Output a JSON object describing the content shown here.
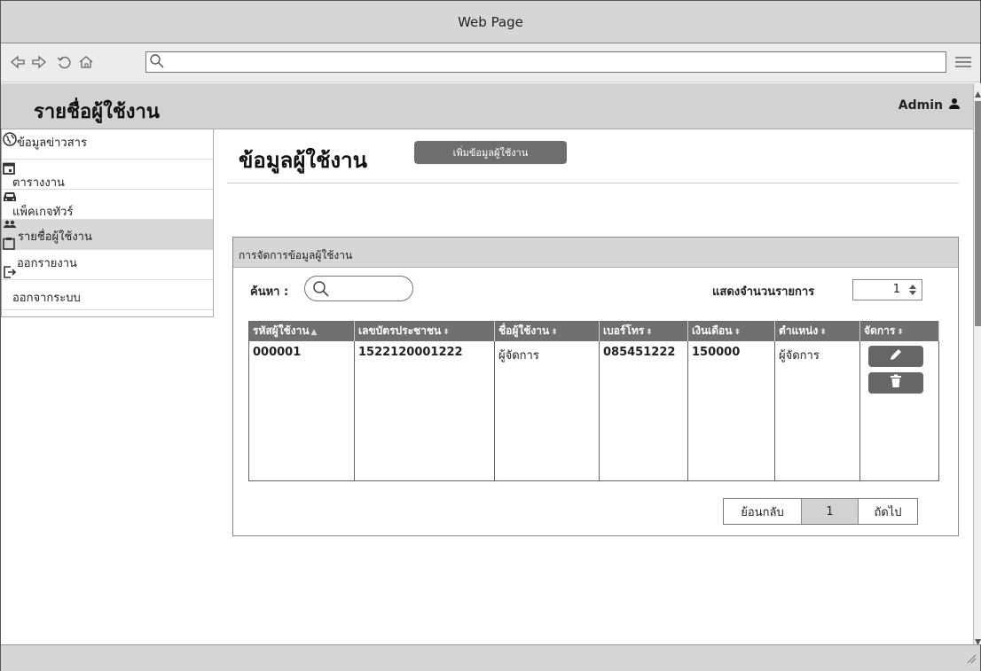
{
  "window": {
    "title": "Web Page"
  },
  "app": {
    "title": "รายชื่อผู้ใช้งาน",
    "user": "Admin"
  },
  "sidebar": {
    "items": [
      {
        "label": "ข้อมูลข่าวสาร",
        "icon": "globe-icon"
      },
      {
        "label": "ตารางงาน",
        "icon": "calendar-icon"
      },
      {
        "label": "แพ็คเกจทัวร์",
        "icon": "car-icon"
      },
      {
        "label": "รายชื่อผู้ใช้งาน",
        "icon": "users-icon"
      },
      {
        "label": "ออกรายงาน",
        "icon": "clipboard-icon"
      },
      {
        "label": "ออกจากระบบ",
        "icon": "sign-out-icon"
      }
    ],
    "active_index": 3
  },
  "main": {
    "title": "ข้อมูลผู้ใช้งาน",
    "add_button": "เพิ่มข้อมูลผู้ใช้งาน"
  },
  "panel": {
    "title": "การจัดการข้อมูลผู้ใช้งาน",
    "search_label": "ค้นหา :",
    "search_placeholder": "",
    "show_label": "แสดงจำนวนรายการ",
    "show_count": "1"
  },
  "table": {
    "columns": [
      "รหัสผู้ใช้งาน",
      "เลขบัตรประชาชน",
      "ชื่อผู้ใช้งาน",
      "เบอร์โทร",
      "เงินเดือน",
      "ตำแหน่ง",
      "จัดการ"
    ],
    "rows": [
      {
        "id": "000001",
        "citizen_id": "1522120001222",
        "name": "ผู้จัดการ",
        "phone": "085451222",
        "salary": "150000",
        "position": "ผู้จัดการ"
      }
    ]
  },
  "pager": {
    "back": "ย้อนกลับ",
    "page": "1",
    "next": "ถัดไป"
  },
  "colors": {
    "header_gray": "#d2d2d2",
    "button_gray": "#6e6e6e",
    "table_header": "#707070"
  }
}
